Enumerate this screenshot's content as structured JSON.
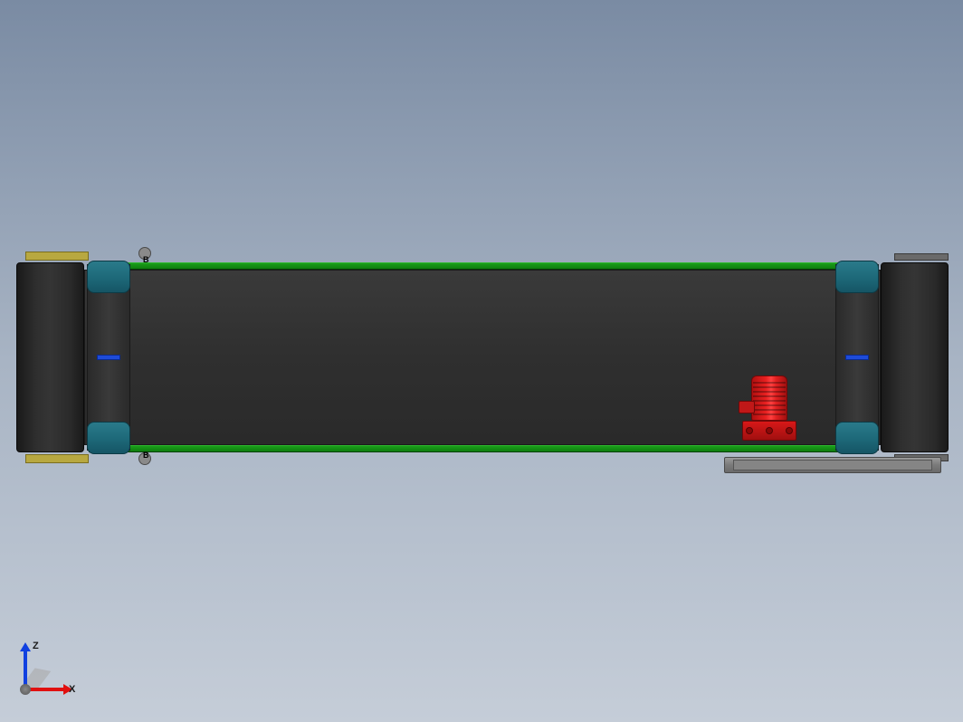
{
  "triad": {
    "axis_z": "Z",
    "axis_x": "X"
  },
  "conveyor": {
    "labels": {
      "bearing_top": "B",
      "bearing_bot": "B"
    }
  },
  "colors": {
    "belt": "#2f2f2f",
    "rail": "#1a9e1a",
    "bearing": "#1e6a7a",
    "motor": "#d81818",
    "plate": "#7a7a7a"
  }
}
